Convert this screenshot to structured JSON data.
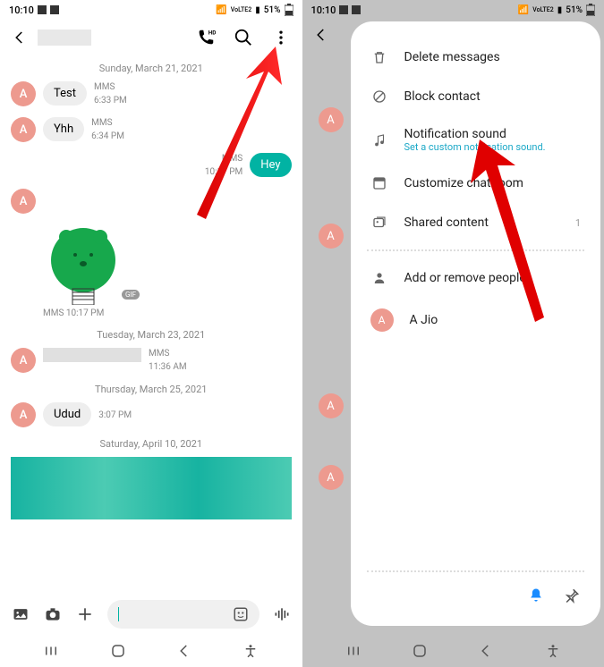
{
  "status": {
    "time": "10:10",
    "battery": "51%",
    "network_label": "VoLTE2",
    "signal_icon": "signal-icon"
  },
  "left": {
    "header": {
      "back_icon": "chevron-left",
      "call_icon": "phone-hd",
      "search_icon": "search",
      "more_icon": "more-vertical"
    },
    "avatar_letter": "A",
    "dates": {
      "d1": "Sunday, March 21, 2021",
      "d2": "Tuesday, March 23, 2021",
      "d3": "Thursday, March 25, 2021",
      "d4": "Saturday, April 10, 2021"
    },
    "msgs": {
      "m1": {
        "text": "Test",
        "type": "MMS",
        "time": "6:33 PM"
      },
      "m2": {
        "text": "Yhh",
        "type": "MMS",
        "time": "6:34 PM"
      },
      "m3_out": {
        "text": "Hey",
        "type": "MMS",
        "time": "10:17 PM"
      },
      "sticker_meta": "MMS 10:17 PM",
      "gif_label": "GIF",
      "m4": {
        "type": "MMS",
        "time": "11:36 AM"
      },
      "m5": {
        "text": "Udud",
        "time": "3:07 PM"
      }
    },
    "input": {
      "image_icon": "image",
      "camera_icon": "camera",
      "plus_icon": "plus",
      "emoji_icon": "sticker",
      "voice_icon": "audio-wave"
    }
  },
  "right": {
    "menu": {
      "delete": "Delete messages",
      "block": "Block contact",
      "notif": "Notification sound",
      "notif_sub": "Set a custom notification sound.",
      "customize": "Customize chat room",
      "shared": "Shared content",
      "shared_count": "1",
      "add_people": "Add or remove people",
      "contact_name": "A Jio"
    },
    "bottom": {
      "bell_icon": "bell",
      "pin_icon": "pin"
    }
  },
  "nav": {
    "recents": "|||",
    "home": "home",
    "back": "back",
    "accessibility": "accessibility"
  }
}
